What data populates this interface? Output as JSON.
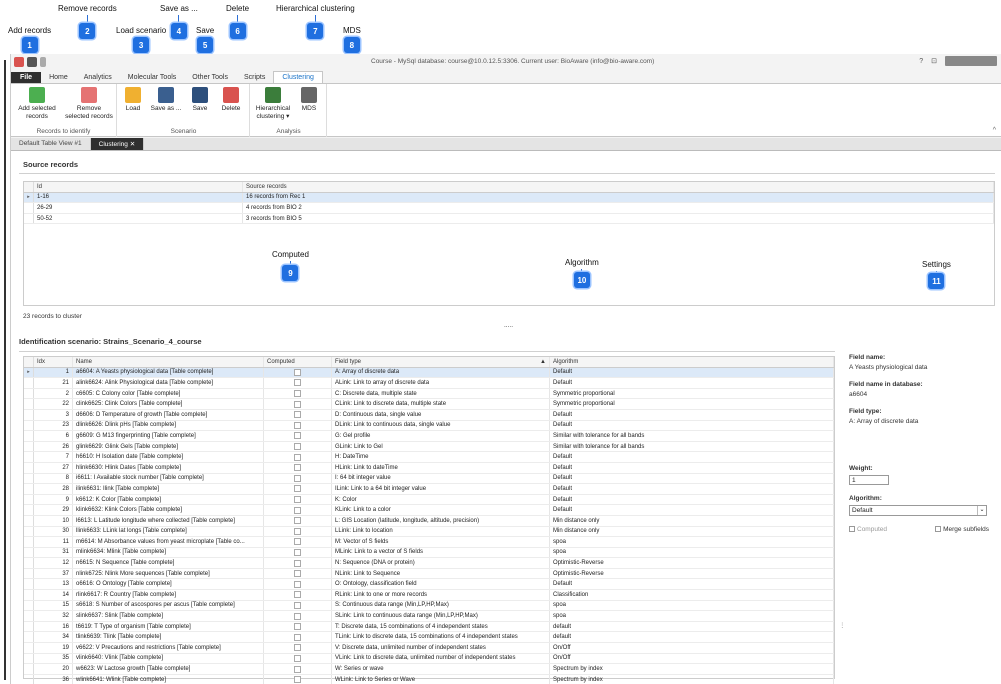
{
  "callouts": [
    {
      "label": "Add records",
      "num": "1"
    },
    {
      "label": "Remove records",
      "num": "2"
    },
    {
      "label": "Load scenario",
      "num": "3"
    },
    {
      "label": "Save as ...",
      "num": "4"
    },
    {
      "label": "Save",
      "num": "5"
    },
    {
      "label": "Delete",
      "num": "6"
    },
    {
      "label": "Hierarchical clustering",
      "num": "7"
    },
    {
      "label": "MDS",
      "num": "8"
    },
    {
      "label": "Computed",
      "num": "9"
    },
    {
      "label": "Algorithm",
      "num": "10"
    },
    {
      "label": "Settings",
      "num": "11"
    }
  ],
  "window": {
    "title": "Course - MySql database: course@10.0.12.5:3306. Current user: BioAware (info@bio-aware.com)",
    "help": "?",
    "restore": "⊡"
  },
  "menu_tabs": [
    "File",
    "Home",
    "Analytics",
    "Molecular Tools",
    "Other Tools",
    "Scripts",
    "Clustering"
  ],
  "ribbon": {
    "groups": [
      {
        "label": "Records to identify",
        "buttons": [
          "Add selected records",
          "Remove selected records"
        ]
      },
      {
        "label": "Scenario",
        "buttons": [
          "Load",
          "Save as ...",
          "Save",
          "Delete"
        ]
      },
      {
        "label": "Analysis",
        "buttons": [
          "Hierarchical clustering ▾",
          "MDS"
        ]
      }
    ],
    "collapse": "^"
  },
  "doc_tabs": [
    "Default Table View #1",
    "Clustering ✕"
  ],
  "source": {
    "title": "Source records",
    "headers": [
      "Id",
      "Source records"
    ],
    "rows": [
      {
        "id": "1-16",
        "src": "16 records from Rec 1"
      },
      {
        "id": "26-29",
        "src": "4 records from BIO 2"
      },
      {
        "id": "50-52",
        "src": "3 records from BIO 5"
      }
    ]
  },
  "cluster_count": "23 records to cluster",
  "splitter": ".....",
  "scenario": {
    "title": "Identification scenario: Strains_Scenario_4_course",
    "headers": [
      "Idx",
      "Name",
      "Computed",
      "Field type",
      "Algorithm"
    ],
    "sort_marker": "▲",
    "rows": [
      {
        "idx": "1",
        "name": "a6604: A Yeasts physiological data [Table complete]",
        "type": "A: Array of discrete data",
        "algo": "Default"
      },
      {
        "idx": "21",
        "name": "alink6624: Alink Physiological data [Table complete]",
        "type": "ALink: Link to array of discrete data",
        "algo": "Default"
      },
      {
        "idx": "2",
        "name": "c6605: C Colony color [Table complete]",
        "type": "C: Discrete data, multiple state",
        "algo": "Symmetric proportional"
      },
      {
        "idx": "22",
        "name": "clink6625: Clink Colors [Table complete]",
        "type": "CLink: Link to discrete data, multiple state",
        "algo": "Symmetric proportional"
      },
      {
        "idx": "3",
        "name": "d6606: D Temperature of growth [Table complete]",
        "type": "D: Continuous data, single value",
        "algo": "Default"
      },
      {
        "idx": "23",
        "name": "dlink6626: Dlink pHs [Table complete]",
        "type": "DLink: Link to continuous data, single value",
        "algo": "Default"
      },
      {
        "idx": "6",
        "name": "g6609: G M13 fingerprinting [Table complete]",
        "type": "G: Gel profile",
        "algo": "Similar with tolerance for all bands"
      },
      {
        "idx": "26",
        "name": "glink6629: Glink Gels [Table complete]",
        "type": "GLink: Link to Gel",
        "algo": "Similar with tolerance for all bands"
      },
      {
        "idx": "7",
        "name": "h6610: H Isolation date [Table complete]",
        "type": "H: DateTime",
        "algo": "Default"
      },
      {
        "idx": "27",
        "name": "hlink6630: Hlink Dates [Table complete]",
        "type": "HLink: Link to dateTime",
        "algo": "Default"
      },
      {
        "idx": "8",
        "name": "i6611: I Available stock number [Table complete]",
        "type": "I: 64 bit integer value",
        "algo": "Default"
      },
      {
        "idx": "28",
        "name": "ilink6631: Ilink [Table complete]",
        "type": "ILink: Link to a 64 bit integer value",
        "algo": "Default"
      },
      {
        "idx": "9",
        "name": "k6612: K Color [Table complete]",
        "type": "K: Color",
        "algo": "Default"
      },
      {
        "idx": "29",
        "name": "klink6632: Klink Colors [Table complete]",
        "type": "KLink: Link to a color",
        "algo": "Default"
      },
      {
        "idx": "10",
        "name": "l6613: L Latitude longitude where collected [Table complete]",
        "type": "L: GIS Location (latitude, longitude, altitude, precision)",
        "algo": "Min distance only"
      },
      {
        "idx": "30",
        "name": "llink6633: LLink lat longs [Table complete]",
        "type": "LLink: Link to location",
        "algo": "Min distance only"
      },
      {
        "idx": "11",
        "name": "m6614: M Absorbance values from yeast microplate [Table co...",
        "type": "M: Vector of S fields",
        "algo": "spoa"
      },
      {
        "idx": "31",
        "name": "mlink6634: Mlink [Table complete]",
        "type": "MLink: Link to a vector of S fields",
        "algo": "spoa"
      },
      {
        "idx": "12",
        "name": "n6615: N Sequence [Table complete]",
        "type": "N: Sequence (DNA or protein)",
        "algo": "Optimistic-Reverse"
      },
      {
        "idx": "37",
        "name": "nlink6725: Nlink More sequences [Table complete]",
        "type": "NLink: Link to Sequence",
        "algo": "Optimistic-Reverse"
      },
      {
        "idx": "13",
        "name": "o6616: O Ontology [Table complete]",
        "type": "O: Ontology, classification field",
        "algo": "Default"
      },
      {
        "idx": "14",
        "name": "rlink6617: R Country [Table complete]",
        "type": "RLink: Link to one or more records",
        "algo": "Classification"
      },
      {
        "idx": "15",
        "name": "s6618: S Number of ascospores per ascus [Table complete]",
        "type": "S: Continuous data range (Min,LP,HP,Max)",
        "algo": "spoa"
      },
      {
        "idx": "32",
        "name": "slink6637: Slink [Table complete]",
        "type": "SLink: Link to continuous data range (Min,LP,HP,Max)",
        "algo": "spoa"
      },
      {
        "idx": "16",
        "name": "t6619: T Type of organism [Table complete]",
        "type": "T: Discrete data, 15 combinations of 4 independent states",
        "algo": "default"
      },
      {
        "idx": "34",
        "name": "tlink6639: Tlink [Table complete]",
        "type": "TLink: Link to discrete data, 15 combinations of 4 independent states",
        "algo": "default"
      },
      {
        "idx": "19",
        "name": "v6622: V Precautions and restrictions [Table complete]",
        "type": "V: Discrete data, unlimited number of independent states",
        "algo": "On/Off"
      },
      {
        "idx": "35",
        "name": "vlink6640: Vlink [Table complete]",
        "type": "VLink: Link to discrete data, unlimited number of independent states",
        "algo": "On/Off"
      },
      {
        "idx": "20",
        "name": "w6623: W Lactose growth [Table complete]",
        "type": "W: Series or wave",
        "algo": "Spectrum by index"
      },
      {
        "idx": "36",
        "name": "wlink6641: Wlink [Table complete]",
        "type": "WLink: Link to Series or Wave",
        "algo": "Spectrum by index"
      }
    ]
  },
  "settings": {
    "field_name_label": "Field name:",
    "field_name_value": "A Yeasts physiological data",
    "db_name_label": "Field name in database:",
    "db_name_value": "a6604",
    "field_type_label": "Field type:",
    "field_type_value": "A: Array of discrete data",
    "weight_label": "Weight:",
    "weight_value": "1",
    "algorithm_label": "Algorithm:",
    "algorithm_value": "Default",
    "computed_label": "Computed",
    "merge_label": "Merge subfields"
  },
  "colors": {
    "accent": "#1f6fe0",
    "selected_row": "#dce9f8",
    "file_tab": "#2f2f2f"
  }
}
